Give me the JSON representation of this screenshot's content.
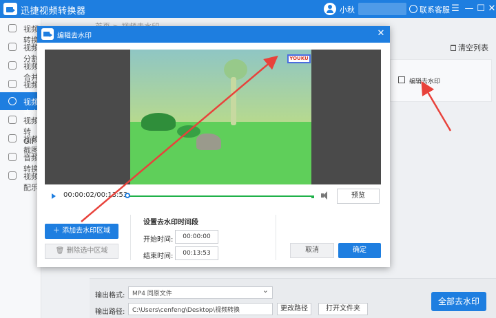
{
  "app": {
    "title": "迅捷视频转换器",
    "user_name": "小秋",
    "support_label": "联系客服",
    "window_controls": [
      "☰",
      "—",
      "☐",
      "✕"
    ]
  },
  "sidebar": {
    "items": [
      {
        "label": "视频转换",
        "icon": "convert-icon"
      },
      {
        "label": "视频分割",
        "icon": "split-icon"
      },
      {
        "label": "视频合并",
        "icon": "merge-icon"
      },
      {
        "label": "视频压缩",
        "icon": "compress-icon"
      },
      {
        "label": "视频去水印",
        "icon": "watermark-icon",
        "active": true
      },
      {
        "label": "视频转GIF",
        "icon": "gif-icon"
      },
      {
        "label": "视频截图",
        "icon": "screenshot-icon"
      },
      {
        "label": "音频转换",
        "icon": "audio-icon"
      },
      {
        "label": "视频配乐",
        "icon": "music-icon"
      }
    ]
  },
  "main": {
    "breadcrumb": "首页 > 视频去水印",
    "clear_list_label": "清空列表",
    "file_card": {
      "edit_label": "编辑去水印"
    }
  },
  "dialog": {
    "title": "编辑去水印",
    "close_symbol": "✕",
    "watermark_text": "YOUKU",
    "time_display": "00:00:02/00:13:53",
    "preview_label": "预览",
    "add_region_label": "＋ 添加去水印区域",
    "delete_region_label": "删除选中区域",
    "time_section_title": "设置去水印时间段",
    "start_label": "开始时间:",
    "start_value": "00:00:00",
    "end_label": "结束时间:",
    "end_value": "00:13:53",
    "cancel_label": "取消",
    "confirm_label": "确定",
    "progress_fraction": 0.0
  },
  "bottom": {
    "format_label": "输出格式:",
    "format_value": "MP4  同原文件",
    "path_label": "输出路径:",
    "path_value": "C:\\Users\\cenfeng\\Desktop\\视频转换",
    "change_path_label": "更改路径",
    "open_folder_label": "打开文件夹",
    "remove_all_label": "全部去水印"
  },
  "colors": {
    "accent": "#1e7ee0",
    "annotation_arrow": "#e8423b",
    "progress": "#20b14a"
  }
}
